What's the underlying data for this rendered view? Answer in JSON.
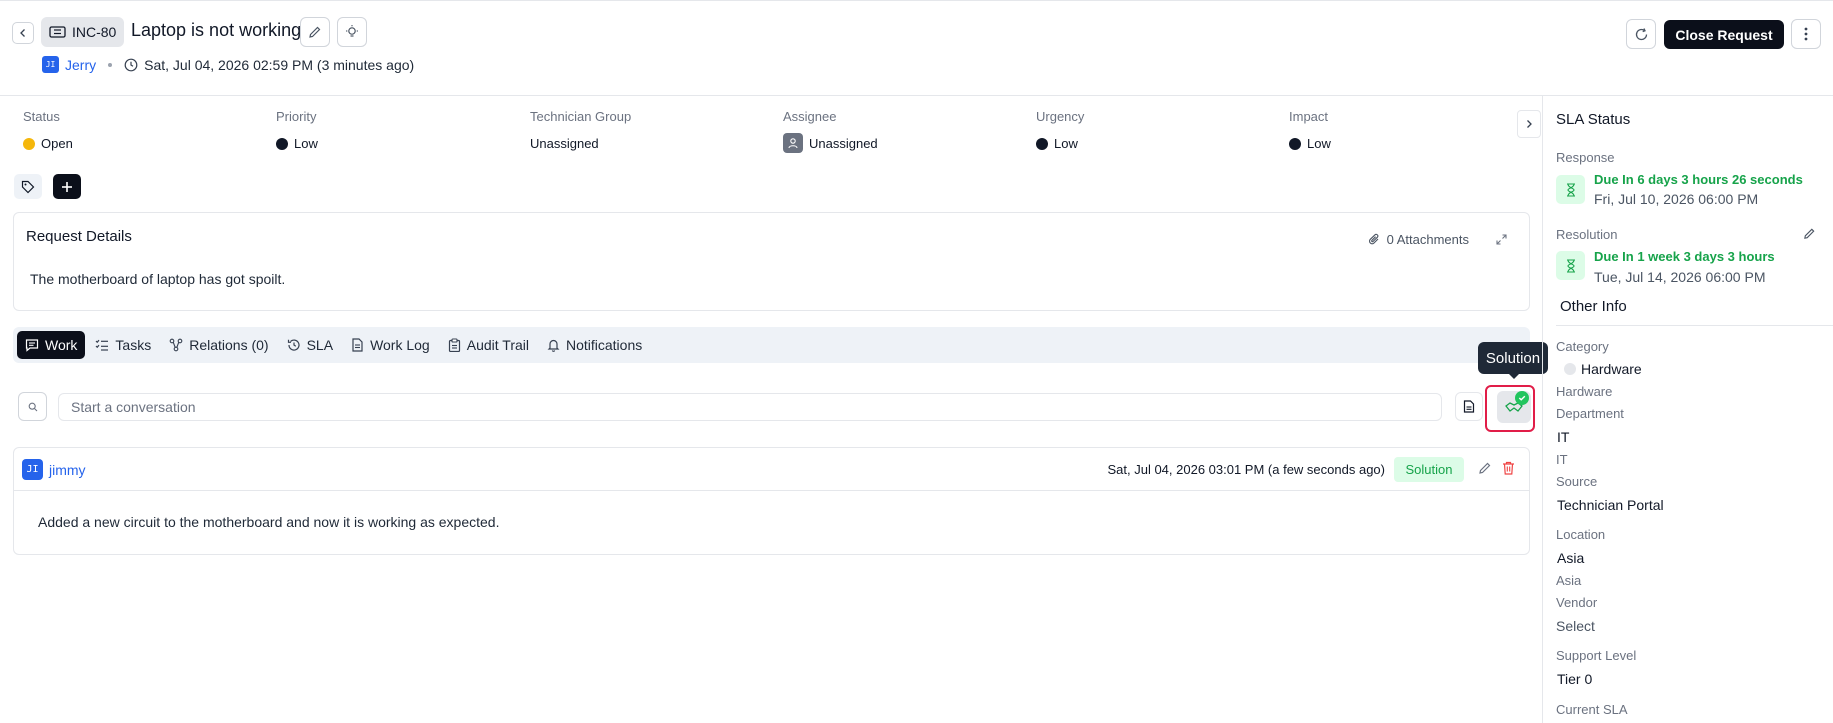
{
  "header": {
    "ticket_id": "INC-80",
    "title": "Laptop is not working",
    "requester_initials": "JI",
    "requester": "Jerry",
    "created": "Sat, Jul 04, 2026 02:59 PM (3 minutes ago)",
    "close_label": "Close Request"
  },
  "fields": [
    {
      "label": "Status",
      "value": "Open",
      "dot_color": "#f5b70b"
    },
    {
      "label": "Priority",
      "value": "Low",
      "dot_color": "#111827"
    },
    {
      "label": "Technician Group",
      "value": "Unassigned"
    },
    {
      "label": "Assignee",
      "value": "Unassigned"
    },
    {
      "label": "Urgency",
      "value": "Low",
      "dot_color": "#111827"
    },
    {
      "label": "Impact",
      "value": "Low",
      "dot_color": "#111827"
    }
  ],
  "details": {
    "title": "Request Details",
    "attachments": "0 Attachments",
    "description": "The motherboard of laptop has got spoilt."
  },
  "tabs": [
    {
      "label": "Work",
      "icon": "message-icon"
    },
    {
      "label": "Tasks",
      "icon": "checklist-icon"
    },
    {
      "label": "Relations (0)",
      "icon": "relations-icon"
    },
    {
      "label": "SLA",
      "icon": "history-icon"
    },
    {
      "label": "Work Log",
      "icon": "file-icon"
    },
    {
      "label": "Audit Trail",
      "icon": "clipboard-icon"
    },
    {
      "label": "Notifications",
      "icon": "bell-icon"
    }
  ],
  "conversation": {
    "placeholder": "Start a conversation",
    "tooltip": "Solution"
  },
  "message": {
    "author_initials": "JI",
    "author": "jimmy",
    "time": "Sat, Jul 04, 2026 03:01 PM (a few seconds ago)",
    "badge": "Solution",
    "body": "Added a new circuit to the motherboard and now it is working as expected."
  },
  "sla": {
    "title": "SLA Status",
    "response_label": "Response",
    "response_due": "Due In 6 days 3 hours 26 seconds",
    "response_date": "Fri, Jul 10, 2026 06:00 PM",
    "resolution_label": "Resolution",
    "resolution_due": "Due In 1 week 3 days 3 hours",
    "resolution_date": "Tue, Jul 14, 2026 06:00 PM"
  },
  "other_info": {
    "title": "Other Info",
    "category_label": "Category",
    "category_value": "Hardware",
    "category_sub": "Hardware",
    "department_label": "Department",
    "department_value": "IT",
    "department_sub": "IT",
    "source_label": "Source",
    "source_value": "Technician Portal",
    "location_label": "Location",
    "location_value": "Asia",
    "location_sub": "Asia",
    "vendor_label": "Vendor",
    "vendor_value": "Select",
    "support_label": "Support Level",
    "support_value": "Tier 0",
    "current_sla_label": "Current SLA"
  }
}
